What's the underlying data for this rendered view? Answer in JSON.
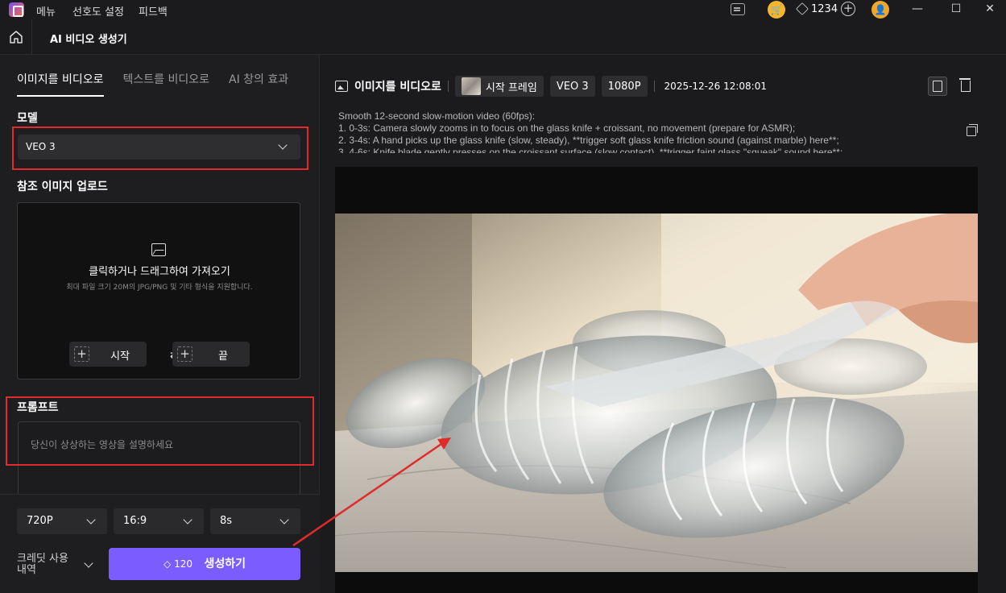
{
  "titlebar": {
    "menu": [
      "메뉴",
      "선호도 설정",
      "피드백"
    ],
    "gem_count": "1234"
  },
  "header": {
    "title": "AI 비디오 생성기"
  },
  "left": {
    "tabs": [
      {
        "label": "이미지를 비디오로",
        "active": true
      },
      {
        "label": "텍스트를 비디오로",
        "active": false
      },
      {
        "label": "AI 창의 효과",
        "active": false
      }
    ],
    "model_label": "모델",
    "model_value": "VEO 3",
    "upload_label": "참조 이미지 업로드",
    "upload_main": "클릭하거나 드래그하여 가져오기",
    "upload_sub": "최대 파일 크기 20M의 JPG/PNG 및 기타 형식을 지원합니다.",
    "start_label": "시작",
    "end_label": "끝",
    "prompt_label": "프롬프트",
    "prompt_placeholder": "당신이 상상하는 영상을 설명하세요",
    "resolution": "720P",
    "ratio": "16:9",
    "duration": "8s",
    "credit_label": "크레딧 사용 내역",
    "generate_cost": "120",
    "generate_label": "생성하기"
  },
  "right": {
    "title": "이미지를 비디오로",
    "frame_chip": "시작 프레임",
    "model_chip": "VEO 3",
    "res_chip": "1080P",
    "datetime": "2025-12-26 12:08:01",
    "prompt_lines": [
      "Smooth 12-second slow-motion video (60fps):",
      "1. 0-3s: Camera slowly zooms in to focus on the glass knife + croissant, no movement (prepare for ASMR);",
      "2. 3-4s: A hand picks up the glass knife (slow, steady), **trigger soft glass knife friction sound (against marble) here**;",
      "3. 4-6s: Knife blade gently presses on the croissant surface (slow contact), **trigger faint glass \"squeak\" sound here**;"
    ]
  },
  "colors": {
    "accent": "#7a5cff",
    "highlight": "#e02b2b",
    "background": "#1b1b1d"
  }
}
